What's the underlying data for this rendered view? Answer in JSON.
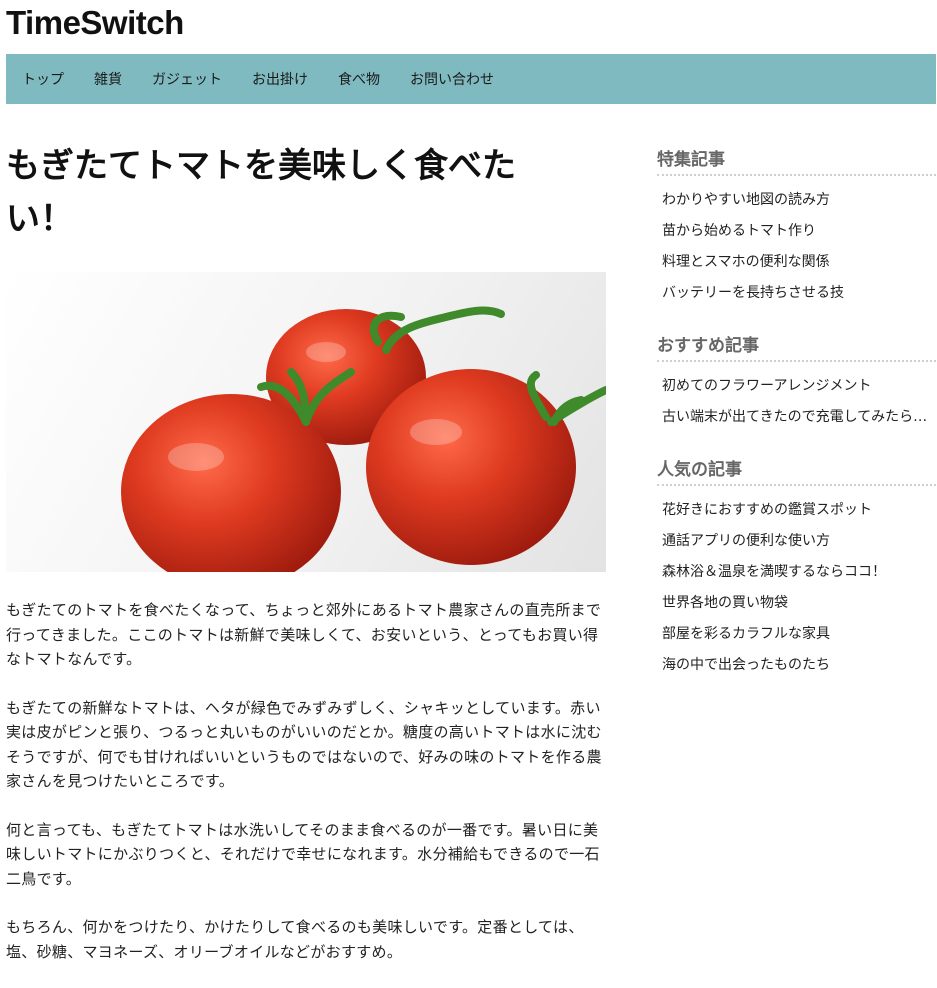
{
  "site": {
    "title": "TimeSwitch"
  },
  "nav": {
    "items": [
      "トップ",
      "雑貨",
      "ガジェット",
      "お出掛け",
      "食べ物",
      "お問い合わせ"
    ]
  },
  "article": {
    "title": "もぎたてトマトを美味しく食べたい！",
    "image": {
      "description_icon": "tomato-photo",
      "colors": {
        "tomato": "#d8321c",
        "stem": "#3f8a2a"
      }
    },
    "paragraphs": [
      "もぎたてのトマトを食べたくなって、ちょっと郊外にあるトマト農家さんの直売所まで行ってきました。ここのトマトは新鮮で美味しくて、お安いという、とってもお買い得なトマトなんです。",
      "もぎたての新鮮なトマトは、ヘタが緑色でみずみずしく、シャキッとしています。赤い実は皮がピンと張り、つるっと丸いものがいいのだとか。糖度の高いトマトは水に沈むそうですが、何でも甘ければいいというものではないので、好みの味のトマトを作る農家さんを見つけたいところです。",
      "何と言っても、もぎたてトマトは水洗いしてそのまま食べるのが一番です。暑い日に美味しいトマトにかぶりつくと、それだけで幸せになれます。水分補給もできるので一石二鳥です。",
      "もちろん、何かをつけたり、かけたりして食べるのも美味しいです。定番としては、塩、砂糖、マヨネーズ、オリーブオイルなどがおすすめ。"
    ]
  },
  "sidebar": {
    "sections": [
      {
        "heading": "特集記事",
        "links": [
          "わかりやすい地図の読み方",
          "苗から始めるトマト作り",
          "料理とスマホの便利な関係",
          "バッテリーを長持ちさせる技"
        ]
      },
      {
        "heading": "おすすめ記事",
        "links": [
          "初めてのフラワーアレンジメント",
          "古い端末が出てきたので充電してみたら…"
        ]
      },
      {
        "heading": "人気の記事",
        "links": [
          "花好きにおすすめの鑑賞スポット",
          "通話アプリの便利な使い方",
          "森林浴＆温泉を満喫するならココ！",
          "世界各地の買い物袋",
          "部屋を彩るカラフルな家具",
          "海の中で出会ったものたち"
        ]
      }
    ]
  },
  "colors": {
    "nav_bg": "#7fbac0",
    "heading_gray": "#666666"
  }
}
